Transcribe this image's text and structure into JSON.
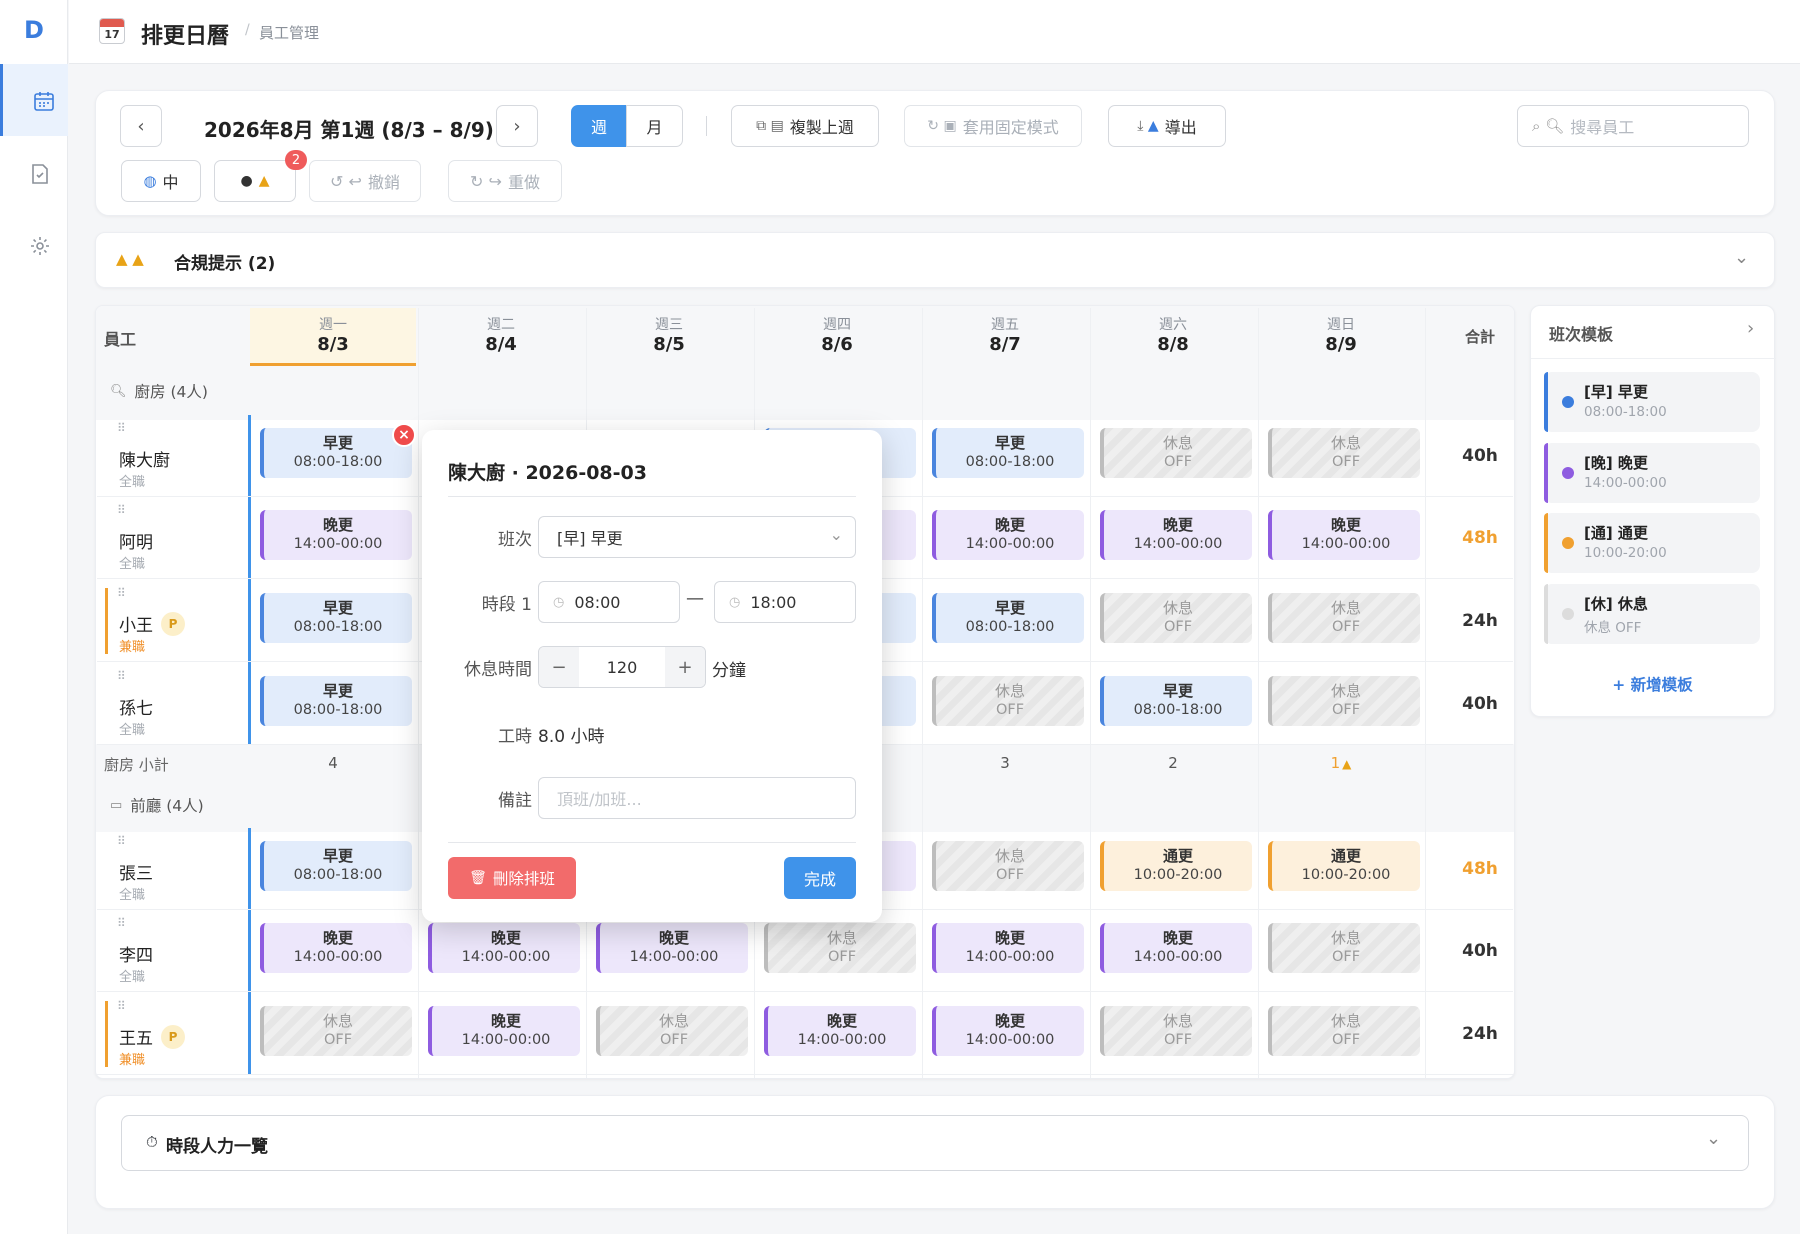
{
  "app": {
    "logo": "D",
    "title": "排更日曆",
    "breadcrumb": "員工管理",
    "calendar_icon_text": "17"
  },
  "toolbar": {
    "period": "2026年8月 第1週 (8/3 – 8/9)",
    "view_week": "週",
    "view_month": "月",
    "copy_last_week": "複製上週",
    "apply_pattern": "套用固定模式",
    "export": "導出",
    "search_placeholder": "搜尋員工",
    "lang": "中",
    "warn_count": "2",
    "undo": "撤銷",
    "redo": "重做"
  },
  "compliance": {
    "title": "合規提示 (2)"
  },
  "table": {
    "emp_header": "員工",
    "total_header": "合計",
    "days": [
      {
        "w": "週一",
        "d": "8/3"
      },
      {
        "w": "週二",
        "d": "8/4"
      },
      {
        "w": "週三",
        "d": "8/5"
      },
      {
        "w": "週四",
        "d": "8/6"
      },
      {
        "w": "週五",
        "d": "8/7"
      },
      {
        "w": "週六",
        "d": "8/8"
      },
      {
        "w": "週日",
        "d": "8/9"
      }
    ],
    "groups": [
      {
        "name": "廚房 (4人)",
        "subtotal_label": "廚房 小計",
        "subtotals": [
          "4",
          "",
          "",
          "",
          "3",
          "2",
          "1"
        ],
        "employees": [
          {
            "name": "陳大廚",
            "type": "全職",
            "part": false,
            "total": "40h",
            "over": false,
            "shifts": [
              [
                "早更",
                "08:00-18:00",
                "m"
              ],
              null,
              null,
              [
                "",
                "",
                "m"
              ],
              [
                "早更",
                "08:00-18:00",
                "m"
              ],
              [
                "休息",
                "OFF",
                "o"
              ],
              [
                "休息",
                "OFF",
                "o"
              ]
            ]
          },
          {
            "name": "阿明",
            "type": "全職",
            "part": false,
            "total": "48h",
            "over": true,
            "shifts": [
              [
                "晚更",
                "14:00-00:00",
                "e"
              ],
              null,
              null,
              [
                "",
                "",
                "e"
              ],
              [
                "晚更",
                "14:00-00:00",
                "e"
              ],
              [
                "晚更",
                "14:00-00:00",
                "e"
              ],
              [
                "晚更",
                "14:00-00:00",
                "e"
              ]
            ]
          },
          {
            "name": "小王",
            "type": "兼職",
            "part": true,
            "total": "24h",
            "over": false,
            "shifts": [
              [
                "早更",
                "08:00-18:00",
                "m"
              ],
              null,
              null,
              [
                "",
                "",
                "m"
              ],
              [
                "早更",
                "08:00-18:00",
                "m"
              ],
              [
                "休息",
                "OFF",
                "o"
              ],
              [
                "休息",
                "OFF",
                "o"
              ]
            ]
          },
          {
            "name": "孫七",
            "type": "全職",
            "part": false,
            "total": "40h",
            "over": false,
            "shifts": [
              [
                "早更",
                "08:00-18:00",
                "m"
              ],
              null,
              null,
              [
                "",
                "",
                "m"
              ],
              [
                "休息",
                "OFF",
                "o"
              ],
              [
                "早更",
                "08:00-18:00",
                "m"
              ],
              [
                "休息",
                "OFF",
                "o"
              ]
            ]
          }
        ]
      },
      {
        "name": "前廳 (4人)",
        "employees": [
          {
            "name": "張三",
            "type": "全職",
            "part": false,
            "total": "48h",
            "over": true,
            "shifts": [
              [
                "早更",
                "08:00-18:00",
                "m"
              ],
              null,
              null,
              [
                "",
                "",
                "e"
              ],
              [
                "休息",
                "OFF",
                "o"
              ],
              [
                "通更",
                "10:00-20:00",
                "g"
              ],
              [
                "通更",
                "10:00-20:00",
                "g"
              ]
            ]
          },
          {
            "name": "李四",
            "type": "全職",
            "part": false,
            "total": "40h",
            "over": false,
            "shifts": [
              [
                "晚更",
                "14:00-00:00",
                "e"
              ],
              [
                "晚更",
                "14:00-00:00",
                "e"
              ],
              [
                "晚更",
                "14:00-00:00",
                "e"
              ],
              [
                "休息",
                "OFF",
                "o"
              ],
              [
                "晚更",
                "14:00-00:00",
                "e"
              ],
              [
                "晚更",
                "14:00-00:00",
                "e"
              ],
              [
                "休息",
                "OFF",
                "o"
              ]
            ]
          },
          {
            "name": "王五",
            "type": "兼職",
            "part": true,
            "total": "24h",
            "over": false,
            "shifts": [
              [
                "休息",
                "OFF",
                "o"
              ],
              [
                "晚更",
                "14:00-00:00",
                "e"
              ],
              [
                "休息",
                "OFF",
                "o"
              ],
              [
                "晚更",
                "14:00-00:00",
                "e"
              ],
              [
                "晚更",
                "14:00-00:00",
                "e"
              ],
              [
                "休息",
                "OFF",
                "o"
              ],
              [
                "休息",
                "OFF",
                "o"
              ]
            ]
          }
        ]
      }
    ]
  },
  "templates": {
    "title": "班次模板",
    "add": "+ 新增模板",
    "items": [
      {
        "name": "[早] 早更",
        "time": "08:00-18:00",
        "color": "#3b7ddd"
      },
      {
        "name": "[晚] 晚更",
        "time": "14:00-00:00",
        "color": "#8e5ce0"
      },
      {
        "name": "[通] 通更",
        "time": "10:00-20:00",
        "color": "#f0a030"
      },
      {
        "name": "[休] 休息",
        "time": "休息 OFF",
        "color": "#dcdcdc"
      }
    ]
  },
  "modal": {
    "title": "陳大廚 · 2026-08-03",
    "shift_label": "班次",
    "shift_value": "[早] 早更",
    "period_label": "時段 1",
    "start": "08:00",
    "end": "18:00",
    "break_label": "休息時間",
    "break_value": "120",
    "break_unit": "分鐘",
    "hours_label": "工時",
    "hours_value": "8.0 小時",
    "note_label": "備註",
    "note_placeholder": "頂班/加班...",
    "delete": "刪除排班",
    "done": "完成"
  },
  "staffing": {
    "title": "時段人力一覽"
  }
}
